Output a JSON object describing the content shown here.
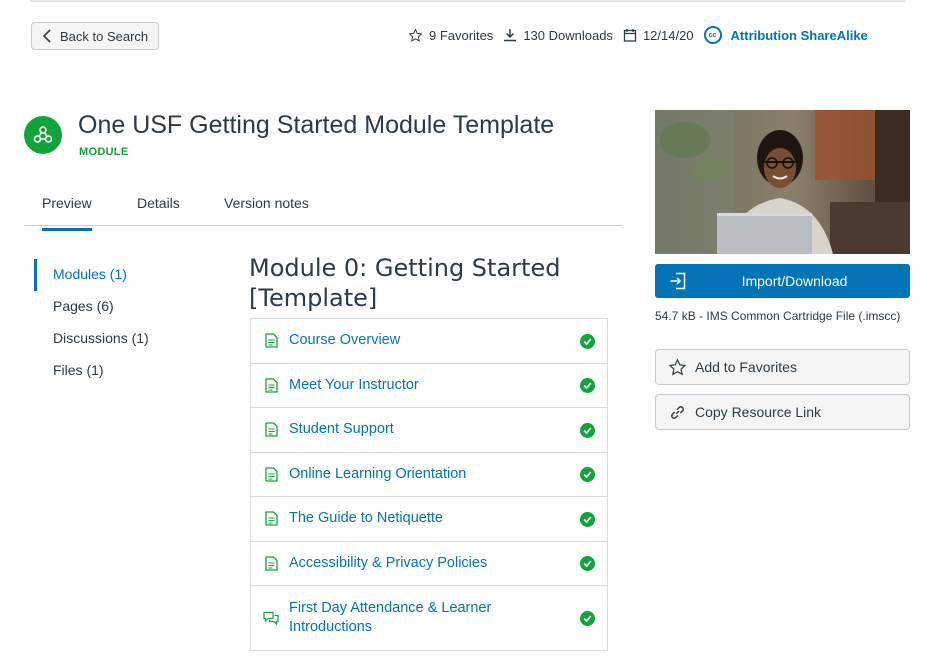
{
  "header": {
    "back_label": "Back to Search",
    "favorites": "9 Favorites",
    "downloads": "130 Downloads",
    "date": "12/14/20",
    "license": "Attribution ShareAlike",
    "license_icon_text": "cc"
  },
  "resource": {
    "title": "One USF Getting Started Module Template",
    "type": "MODULE",
    "type_color": "#12a43a"
  },
  "tabs": [
    {
      "label": "Preview",
      "active": true
    },
    {
      "label": "Details",
      "active": false
    },
    {
      "label": "Version notes",
      "active": false
    }
  ],
  "side_nav": [
    {
      "label": "Modules (1)",
      "active": true
    },
    {
      "label": "Pages (6)",
      "active": false
    },
    {
      "label": "Discussions (1)",
      "active": false
    },
    {
      "label": "Files (1)",
      "active": false
    }
  ],
  "module": {
    "title": "Module 0: Getting Started [Template]",
    "items": [
      {
        "label": "Course Overview",
        "icon": "page-icon",
        "completed": true
      },
      {
        "label": "Meet Your Instructor",
        "icon": "page-icon",
        "completed": true
      },
      {
        "label": "Student Support",
        "icon": "page-icon",
        "completed": true
      },
      {
        "label": "Online Learning Orientation",
        "icon": "page-icon",
        "completed": true
      },
      {
        "label": "The Guide to Netiquette",
        "icon": "page-icon",
        "completed": true
      },
      {
        "label": "Accessibility & Privacy Policies",
        "icon": "page-icon",
        "completed": true
      },
      {
        "label": "First Day Attendance & Learner Introductions",
        "icon": "discussion-icon",
        "completed": true
      }
    ]
  },
  "sidebar": {
    "import_label": "Import/Download",
    "file_info": "54.7 kB - IMS Common Cartridge File (.imscc)",
    "favorite_label": "Add to Favorites",
    "copy_link_label": "Copy Resource Link"
  },
  "colors": {
    "accent": "#0374b5",
    "success": "#12a43a",
    "text": "#2d3b45"
  }
}
